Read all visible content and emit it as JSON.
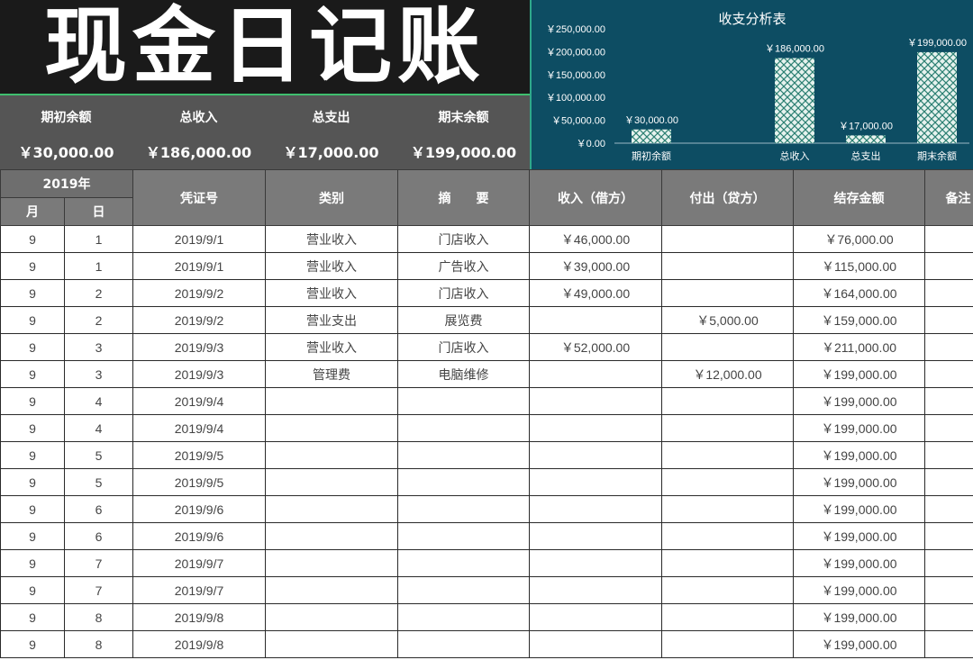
{
  "title": "现金日记账",
  "summary": [
    {
      "label": "期初余额",
      "value": "￥30,000.00"
    },
    {
      "label": "总收入",
      "value": "￥186,000.00"
    },
    {
      "label": "总支出",
      "value": "￥17,000.00"
    },
    {
      "label": "期末余额",
      "value": "￥199,000.00"
    }
  ],
  "chart_data": {
    "type": "bar",
    "title": "收支分析表",
    "categories": [
      "期初余额",
      "总收入",
      "总支出",
      "期末余额"
    ],
    "values": [
      30000,
      186000,
      17000,
      199000
    ],
    "value_labels": [
      "￥30,000.00",
      "￥186,000.00",
      "￥17,000.00",
      "￥199,000.00"
    ],
    "yticks": [
      "￥250,000.00",
      "￥200,000.00",
      "￥150,000.00",
      "￥100,000.00",
      "￥50,000.00",
      "￥0.00"
    ],
    "ylim": [
      0,
      250000
    ],
    "grid": false,
    "colors": {
      "background": "#0d4d63",
      "bar": "#e6f2ee",
      "bar_hatch": "#2b7f72",
      "text": "#ffffff"
    }
  },
  "table": {
    "year_header": "2019年",
    "headers": {
      "month": "月",
      "day": "日",
      "voucher": "凭证号",
      "category": "类别",
      "summary": "摘　　要",
      "income": "收入（借方）",
      "expense": "付出（贷方）",
      "balance": "结存金额",
      "note": "备注"
    },
    "rows": [
      [
        "9",
        "1",
        "2019/9/1",
        "营业收入",
        "门店收入",
        "￥46,000.00",
        "",
        "￥76,000.00",
        ""
      ],
      [
        "9",
        "1",
        "2019/9/1",
        "营业收入",
        "广告收入",
        "￥39,000.00",
        "",
        "￥115,000.00",
        ""
      ],
      [
        "9",
        "2",
        "2019/9/2",
        "营业收入",
        "门店收入",
        "￥49,000.00",
        "",
        "￥164,000.00",
        ""
      ],
      [
        "9",
        "2",
        "2019/9/2",
        "营业支出",
        "展览费",
        "",
        "￥5,000.00",
        "￥159,000.00",
        ""
      ],
      [
        "9",
        "3",
        "2019/9/3",
        "营业收入",
        "门店收入",
        "￥52,000.00",
        "",
        "￥211,000.00",
        ""
      ],
      [
        "9",
        "3",
        "2019/9/3",
        "管理费",
        "电脑维修",
        "",
        "￥12,000.00",
        "￥199,000.00",
        ""
      ],
      [
        "9",
        "4",
        "2019/9/4",
        "",
        "",
        "",
        "",
        "￥199,000.00",
        ""
      ],
      [
        "9",
        "4",
        "2019/9/4",
        "",
        "",
        "",
        "",
        "￥199,000.00",
        ""
      ],
      [
        "9",
        "5",
        "2019/9/5",
        "",
        "",
        "",
        "",
        "￥199,000.00",
        ""
      ],
      [
        "9",
        "5",
        "2019/9/5",
        "",
        "",
        "",
        "",
        "￥199,000.00",
        ""
      ],
      [
        "9",
        "6",
        "2019/9/6",
        "",
        "",
        "",
        "",
        "￥199,000.00",
        ""
      ],
      [
        "9",
        "6",
        "2019/9/6",
        "",
        "",
        "",
        "",
        "￥199,000.00",
        ""
      ],
      [
        "9",
        "7",
        "2019/9/7",
        "",
        "",
        "",
        "",
        "￥199,000.00",
        ""
      ],
      [
        "9",
        "7",
        "2019/9/7",
        "",
        "",
        "",
        "",
        "￥199,000.00",
        ""
      ],
      [
        "9",
        "8",
        "2019/9/8",
        "",
        "",
        "",
        "",
        "￥199,000.00",
        ""
      ],
      [
        "9",
        "8",
        "2019/9/8",
        "",
        "",
        "",
        "",
        "￥199,000.00",
        ""
      ]
    ]
  }
}
